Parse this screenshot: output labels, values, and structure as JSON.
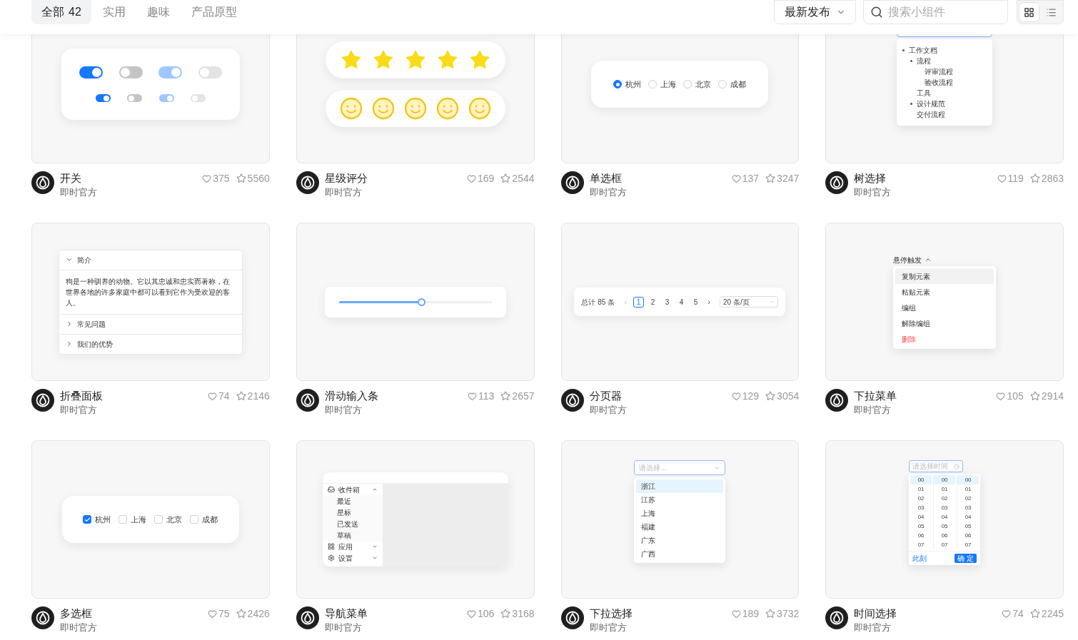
{
  "header": {
    "tabs": [
      {
        "label": "全部",
        "count": "42",
        "selected": true
      },
      {
        "label": "实用",
        "selected": false
      },
      {
        "label": "趣味",
        "selected": false
      },
      {
        "label": "产品原型",
        "selected": false
      }
    ],
    "sort": {
      "label": "最新发布"
    },
    "search": {
      "placeholder": "搜索小组件"
    },
    "view_toggle": [
      {
        "kind": "grid",
        "selected": true
      },
      {
        "kind": "list",
        "selected": false
      }
    ]
  },
  "widgets": [
    {
      "title": "开关",
      "author": "即时官方",
      "likes": "375",
      "favorites": "5560",
      "preview": {
        "kind": "switch",
        "rows": [
          {
            "kind": "large",
            "switches": [
              {
                "checked": true,
                "disabled": false
              },
              {
                "checked": false,
                "disabled": false
              },
              {
                "checked": true,
                "disabled": true
              },
              {
                "checked": false,
                "disabled": true
              }
            ]
          },
          {
            "kind": "small",
            "switches": [
              {
                "checked": true,
                "disabled": false
              },
              {
                "checked": false,
                "disabled": false
              },
              {
                "checked": true,
                "disabled": true
              },
              {
                "checked": false,
                "disabled": true
              }
            ]
          }
        ]
      }
    },
    {
      "title": "星级评分",
      "author": "即时官方",
      "likes": "169",
      "favorites": "2544",
      "preview": {
        "kind": "rating",
        "rows": [
          {
            "kind": "star",
            "stars": 5
          },
          {
            "kind": "face",
            "stars": 5
          }
        ]
      }
    },
    {
      "title": "单选框",
      "author": "即时官方",
      "likes": "137",
      "favorites": "3247",
      "preview": {
        "kind": "radio",
        "options": [
          {
            "label": "杭州",
            "selected": true
          },
          {
            "label": "上海",
            "selected": false
          },
          {
            "label": "北京",
            "selected": false
          },
          {
            "label": "成都",
            "selected": false
          }
        ]
      }
    },
    {
      "title": "树选择",
      "author": "即时官方",
      "likes": "119",
      "favorites": "2863",
      "preview": {
        "kind": "tree",
        "nodes": [
          {
            "label": "工作文档",
            "expandable": true,
            "children": [
              {
                "label": "流程",
                "expandable": true,
                "children": [
                  {
                    "label": "评审流程",
                    "expandable": false
                  },
                  {
                    "label": "验收流程",
                    "expandable": false
                  }
                ]
              },
              {
                "label": "工具",
                "expandable": false
              },
              {
                "label": "设计规范",
                "expandable": true
              },
              {
                "label": "交付流程",
                "expandable": false
              }
            ]
          }
        ]
      }
    },
    {
      "title": "折叠面板",
      "author": "即时官方",
      "likes": "74",
      "favorites": "2146",
      "preview": {
        "kind": "collapse",
        "panels": [
          {
            "title": "简介",
            "expanded": true,
            "content": "狗是一种驯养的动物。它以其忠诚和忠实而著称，在世界各地的许多家庭中都可以看到它作为受欢迎的客人。"
          },
          {
            "title": "常见问题",
            "expanded": false
          },
          {
            "title": "我们的优势",
            "expanded": false
          }
        ]
      }
    },
    {
      "title": "滑动输入条",
      "author": "即时官方",
      "likes": "113",
      "favorites": "2657",
      "preview": {
        "kind": "slider",
        "level": 0.54
      }
    },
    {
      "title": "分页器",
      "author": "即时官方",
      "likes": "129",
      "favorites": "3054",
      "preview": {
        "kind": "pagination",
        "total": "总计 85 条",
        "prev": "‹",
        "pages": [
          {
            "label": "1",
            "selected": true
          },
          {
            "label": "2",
            "selected": false
          },
          {
            "label": "3",
            "selected": false
          },
          {
            "label": "4",
            "selected": false
          },
          {
            "label": "5",
            "selected": false
          }
        ],
        "next": "›",
        "page_size": "20 条/页"
      }
    },
    {
      "title": "下拉菜单",
      "author": "即时官方",
      "likes": "105",
      "favorites": "2914",
      "preview": {
        "kind": "dropdown",
        "trigger": "悬停触发",
        "items": [
          {
            "label": "复制元素",
            "kind": "normal",
            "selected": true
          },
          {
            "label": "粘贴元素",
            "kind": "normal",
            "selected": false
          },
          {
            "label": "编组",
            "kind": "normal",
            "selected": false
          },
          {
            "label": "解除编组",
            "kind": "normal",
            "selected": false
          },
          {
            "label": "删除",
            "kind": "danger",
            "selected": false
          }
        ]
      }
    },
    {
      "title": "多选框",
      "author": "即时官方",
      "likes": "75",
      "favorites": "2426",
      "preview": {
        "kind": "checkbox",
        "options": [
          {
            "label": "杭州",
            "checked": true
          },
          {
            "label": "上海",
            "checked": false
          },
          {
            "label": "北京",
            "checked": false
          },
          {
            "label": "成都",
            "checked": false
          }
        ]
      }
    },
    {
      "title": "导航菜单",
      "author": "即时官方",
      "likes": "106",
      "favorites": "3168",
      "preview": {
        "kind": "navmenu",
        "groups": [
          {
            "kind": "inbox",
            "label": "收件箱",
            "expanded": true,
            "children": [
              {
                "label": "最近"
              },
              {
                "label": "星标"
              },
              {
                "label": "已发送"
              },
              {
                "label": "草稿"
              }
            ]
          },
          {
            "kind": "apps",
            "label": "应用",
            "expanded": false
          },
          {
            "kind": "settings",
            "label": "设置",
            "expanded": false
          }
        ]
      }
    },
    {
      "title": "下拉选择",
      "author": "即时官方",
      "likes": "189",
      "favorites": "3732",
      "preview": {
        "kind": "select",
        "placeholder": "请选择...",
        "options": [
          {
            "label": "浙江",
            "selected": true
          },
          {
            "label": "江苏",
            "selected": false
          },
          {
            "label": "上海",
            "selected": false
          },
          {
            "label": "福建",
            "selected": false
          },
          {
            "label": "广东",
            "selected": false
          },
          {
            "label": "广西",
            "selected": false
          }
        ]
      }
    },
    {
      "title": "时间选择",
      "author": "即时官方",
      "likes": "74",
      "favorites": "2245",
      "preview": {
        "kind": "timepicker",
        "placeholder": "请选择时间",
        "columns": [
          {
            "cells": [
              {
                "label": "00",
                "selected": true
              },
              {
                "label": "01",
                "selected": false
              },
              {
                "label": "02",
                "selected": false
              },
              {
                "label": "03",
                "selected": false
              },
              {
                "label": "04",
                "selected": false
              },
              {
                "label": "05",
                "selected": false
              },
              {
                "label": "06",
                "selected": false
              },
              {
                "label": "07",
                "selected": false
              }
            ]
          },
          {
            "cells": [
              {
                "label": "00",
                "selected": true
              },
              {
                "label": "01",
                "selected": false
              },
              {
                "label": "02",
                "selected": false
              },
              {
                "label": "03",
                "selected": false
              },
              {
                "label": "04",
                "selected": false
              },
              {
                "label": "05",
                "selected": false
              },
              {
                "label": "06",
                "selected": false
              },
              {
                "label": "07",
                "selected": false
              }
            ]
          },
          {
            "cells": [
              {
                "label": "00",
                "selected": true
              },
              {
                "label": "01",
                "selected": false
              },
              {
                "label": "02",
                "selected": false
              },
              {
                "label": "03",
                "selected": false
              },
              {
                "label": "04",
                "selected": false
              },
              {
                "label": "05",
                "selected": false
              },
              {
                "label": "06",
                "selected": false
              },
              {
                "label": "07",
                "selected": false
              }
            ]
          }
        ],
        "now": "此刻",
        "confirm": "确 定"
      }
    }
  ]
}
